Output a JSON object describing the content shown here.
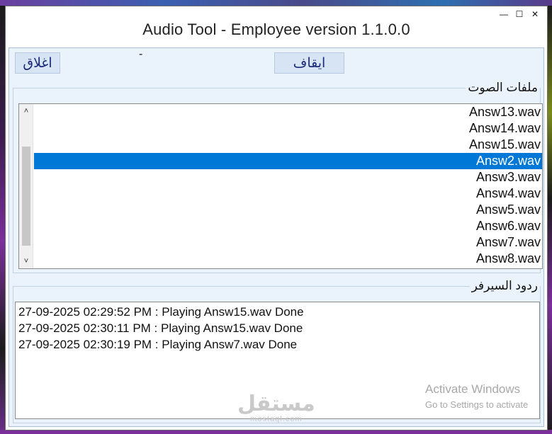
{
  "window": {
    "title": "Audio Tool - Employee version 1.1.0.0",
    "controls": {
      "minimize": "—",
      "maximize": "☐",
      "close": "✕"
    }
  },
  "toolbar": {
    "close_label": "اغلاق",
    "stop_label": "ايقاف",
    "status_text": "-"
  },
  "audio_files": {
    "group_label": "ملفات الصوت",
    "items": [
      "Answ13.wav",
      "Answ14.wav",
      "Answ15.wav",
      "Answ2.wav",
      "Answ3.wav",
      "Answ4.wav",
      "Answ5.wav",
      "Answ6.wav",
      "Answ7.wav",
      "Answ8.wav"
    ],
    "selected": "Answ2.wav",
    "scroll_up_icon": "˄",
    "scroll_down_icon": "˅"
  },
  "server_responses": {
    "group_label": "ردود السيرفر",
    "lines": [
      "27-09-2025 02:29:52 PM : Playing Answ15.wav Done",
      "27-09-2025 02:30:11 PM : Playing Answ15.wav Done",
      "27-09-2025 02:30:19 PM : Playing Answ7.wav Done"
    ]
  },
  "overlay": {
    "activate_title": "Activate Windows",
    "activate_sub": "Go to Settings to activate",
    "logo_ar": "مستقل",
    "logo_en": "mostaql.com"
  },
  "colors": {
    "selection": "#0078d7",
    "client_bg": "#eaf2fb",
    "button_bg": "#d7e4f4"
  }
}
